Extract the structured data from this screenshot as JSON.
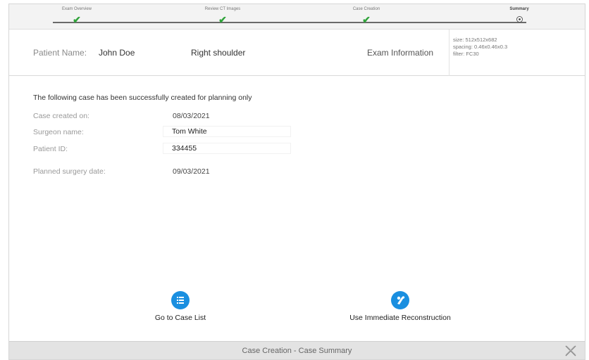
{
  "stepper": {
    "steps": [
      {
        "label": "Exam Overview",
        "state": "done"
      },
      {
        "label": "Review CT Images",
        "state": "done"
      },
      {
        "label": "Case Creation",
        "state": "done"
      },
      {
        "label": "Summary",
        "state": "current"
      }
    ]
  },
  "patient": {
    "name_label": "Patient Name:",
    "name_value": "John Doe",
    "region": "Right shoulder",
    "exam_label": "Exam Information",
    "exam_size": "size: 512x512x682",
    "exam_spacing": "spacing: 0.46x0.46x0.3",
    "exam_filter": "filter: FC30"
  },
  "summary": {
    "intro": "The following case has been successfully created for planning only",
    "fields": [
      {
        "label": "Case created on:",
        "value": "08/03/2021"
      },
      {
        "label": "Surgeon name:",
        "value": "Tom White"
      },
      {
        "label": "Patient ID:",
        "value": "334455"
      },
      {
        "label": "Planned surgery date:",
        "value": "09/03/2021"
      }
    ]
  },
  "actions": {
    "case_list": {
      "label": "Go to Case List",
      "icon": "list-icon"
    },
    "reconstruction": {
      "label": "Use Immediate Reconstruction",
      "icon": "shoulder-implant-icon"
    }
  },
  "footer": {
    "title": "Case Creation - Case Summary"
  },
  "colors": {
    "accent": "#1a8fe0",
    "check": "#2fa33a",
    "footer_bg": "#e3e3e3"
  }
}
